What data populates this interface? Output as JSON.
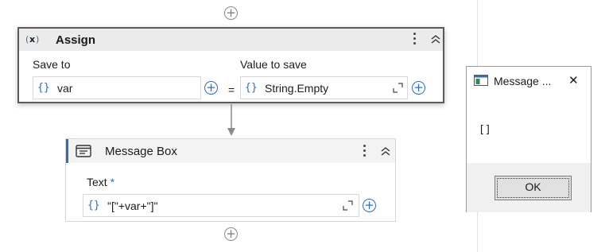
{
  "assign": {
    "title": "Assign",
    "icon": "variable-x-icon",
    "save_to_label": "Save to",
    "value_label": "Value to save",
    "save_to_value": "var",
    "equals": "=",
    "value_to_save": "String.Empty",
    "brace": "{}"
  },
  "message_box": {
    "title": "Message Box",
    "text_label": "Text",
    "required_mark": "*",
    "text_value": "\"[\"+var+\"]\"",
    "brace": "{}"
  },
  "dialog": {
    "title": "Message ...",
    "body": "[]",
    "ok_label": "OK",
    "close_glyph": "✕"
  },
  "glyphs": {
    "plus": "+",
    "collapse": "︽"
  },
  "colors": {
    "accent": "#2f6fb8",
    "required": "#2f6fb8"
  }
}
